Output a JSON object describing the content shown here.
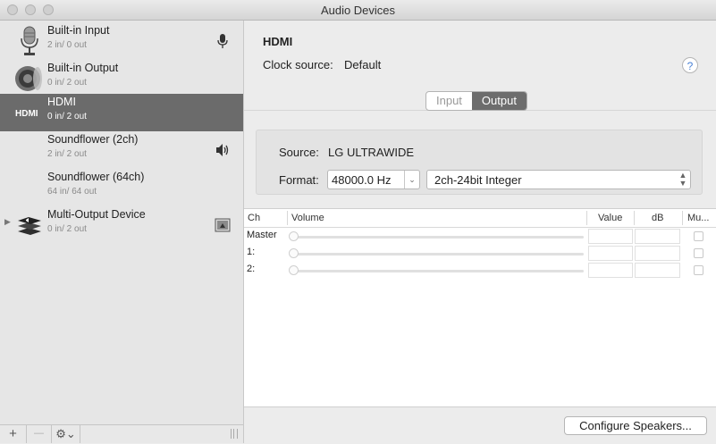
{
  "window": {
    "title": "Audio Devices"
  },
  "devices": [
    {
      "name": "Built-in Input",
      "io": "2 in/ 0 out",
      "icon": "microphone-icon",
      "right_icon": "mic-small-icon"
    },
    {
      "name": "Built-in Output",
      "io": "0 in/ 2 out",
      "icon": "speaker-icon",
      "right_icon": ""
    },
    {
      "name": "HDMI",
      "io": "0 in/ 2 out",
      "icon": "hdmi-icon",
      "right_icon": ""
    },
    {
      "name": "Soundflower (2ch)",
      "io": "2 in/ 2 out",
      "icon": "",
      "right_icon": "volume-icon"
    },
    {
      "name": "Soundflower (64ch)",
      "io": "64 in/ 64 out",
      "icon": "",
      "right_icon": ""
    },
    {
      "name": "Multi-Output Device",
      "io": "0 in/ 2 out",
      "icon": "multi-output-icon",
      "right_icon": "finder-icon"
    }
  ],
  "selected_device": "HDMI",
  "toolbar": {
    "add": "+",
    "remove": "—",
    "gear": "⚙⌄"
  },
  "detail": {
    "name": "HDMI",
    "clock_label": "Clock source:",
    "clock_value": "Default",
    "help": "?",
    "tabs": [
      "Input",
      "Output"
    ],
    "active_tab": "Output",
    "source_label": "Source:",
    "source_value": "LG ULTRAWIDE",
    "format_label": "Format:",
    "format_rate": "48000.0 Hz",
    "format_bits": "2ch-24bit Integer"
  },
  "table": {
    "headers": [
      "Ch",
      "Volume",
      "Value",
      "dB",
      "Mu..."
    ],
    "rows": [
      "Master",
      "1:",
      "2:"
    ]
  },
  "configure_button": "Configure Speakers..."
}
